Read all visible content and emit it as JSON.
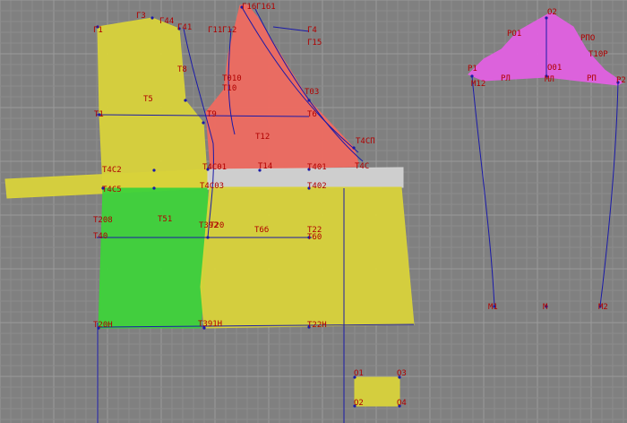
{
  "colors": {
    "background": "#808080",
    "grid_minor": "#8c8c8c",
    "grid_major": "#9a9a9a",
    "label": "#b00000",
    "line": "#1a1aa8",
    "yellow": "#d8d23a",
    "green": "#3ed23a",
    "red": "#ee6a60",
    "pink": "#e060e0",
    "band": "#d2d2d2"
  },
  "labels": {
    "g1": "Г1",
    "g3": "Г3",
    "g44": "Г44",
    "g41": "Г41",
    "g11": "Г11",
    "g12": "Г12",
    "g16": "Г16",
    "g161": "Г161",
    "g4": "Г4",
    "g15": "Г15",
    "t8": "Т8",
    "t5": "Т5",
    "t010": "Т010",
    "t10": "Т10",
    "t03": "Т03",
    "t1": "Т1",
    "t9": "Т9",
    "t6": "Т6",
    "t12": "Т12",
    "t4cp": "Т4СП",
    "t4c2": "Т4С2",
    "t4c5": "Т4С5",
    "t4c01": "Т4С01",
    "t4c03": "Т4С03",
    "t14": "Т14",
    "t401": "Т401",
    "t4c": "Т4С",
    "t402": "Т402",
    "t208": "Т208",
    "t51": "Т51",
    "t392": "Т392",
    "t20": "Т20",
    "t40": "Т40",
    "t6b": "Т6б",
    "t22": "Т22",
    "t60": "Т60",
    "t20h": "Т20Н",
    "t391h": "Т391Н",
    "t22h": "Т22Н",
    "o2": "О2",
    "po1": "РО1",
    "rpo": "РПО",
    "p1": "Р1",
    "o01": "О01",
    "m12": "М12",
    "rl": "РЛ",
    "ml": "МЛ",
    "rp": "РП",
    "t10p": "Т10Р",
    "p2": "Р2",
    "m1": "М1",
    "m": "М",
    "m2": "М2",
    "c_o1": "О1",
    "c_o3": "О3",
    "c_o2": "О2",
    "c_o4": "О4"
  }
}
